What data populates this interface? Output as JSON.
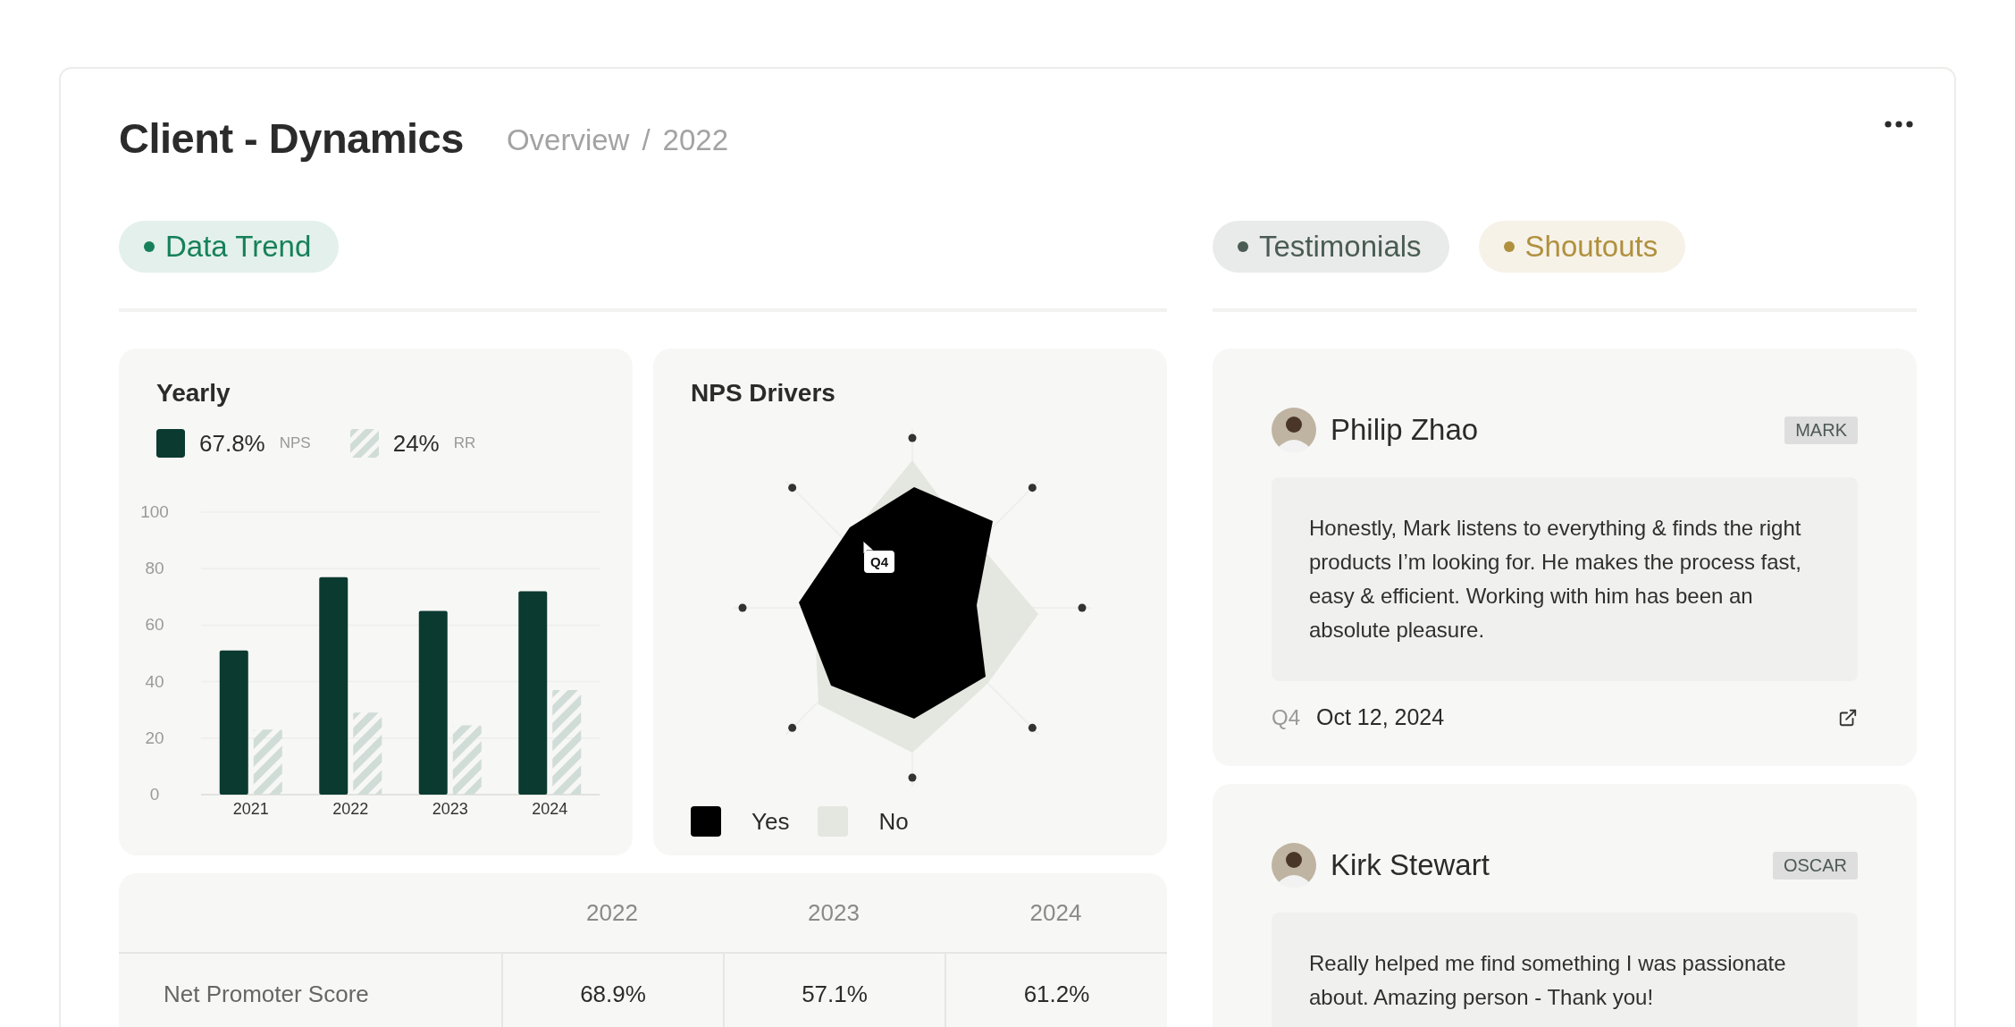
{
  "header": {
    "title": "Client - Dynamics",
    "breadcrumb": [
      "Overview",
      "2022"
    ],
    "separator": "/"
  },
  "left_tags": [
    {
      "label": "Data Trend",
      "color": "#16805a"
    }
  ],
  "right_tags": [
    {
      "label": "Testimonials",
      "color": "#4a5c54"
    },
    {
      "label": "Shoutouts",
      "color": "#b0903e"
    }
  ],
  "yearly": {
    "legend": [
      {
        "value": "67.8%"
      },
      {
        "value": "24%"
      }
    ],
    "chart_data": {
      "type": "bar",
      "title": "Yearly",
      "grid": true,
      "categories": [
        "2021",
        "2022",
        "2023",
        "2024"
      ],
      "series": [
        {
          "name": "NPS",
          "color": "#0b3a30",
          "values": [
            51,
            77,
            65,
            72
          ]
        },
        {
          "name": "RR",
          "color": "#d0dcd8",
          "values": [
            23,
            29,
            24.5,
            37
          ]
        }
      ],
      "ylim": [
        0,
        100
      ],
      "yticks": [
        0,
        20,
        40,
        60,
        80,
        100
      ]
    }
  },
  "nps_drivers": {
    "title": "NPS Drivers",
    "tooltip": "Q4",
    "legend": [
      {
        "label": "Yes",
        "color": "#000000"
      },
      {
        "label": "No",
        "color": "#e4e6e0"
      }
    ]
  },
  "table": {
    "columns": [
      "2022",
      "2023",
      "2024"
    ],
    "rows": [
      {
        "label": "Net Promoter Score",
        "values": [
          "68.9%",
          "57.1%",
          "61.2%"
        ]
      }
    ]
  },
  "testimonials": [
    {
      "name": "Philip Zhao",
      "tag": "MARK",
      "quote": "Honestly, Mark listens to everything & finds the right products I’m looking for. He makes the process fast, easy & efficient. Working with him has been an absolute pleasure.",
      "quarter": "Q4",
      "date": "Oct 12, 2024"
    },
    {
      "name": "Kirk Stewart",
      "tag": "OSCAR",
      "quote": "Really helped me find something I was passionate about. Amazing person - Thank you!"
    }
  ]
}
